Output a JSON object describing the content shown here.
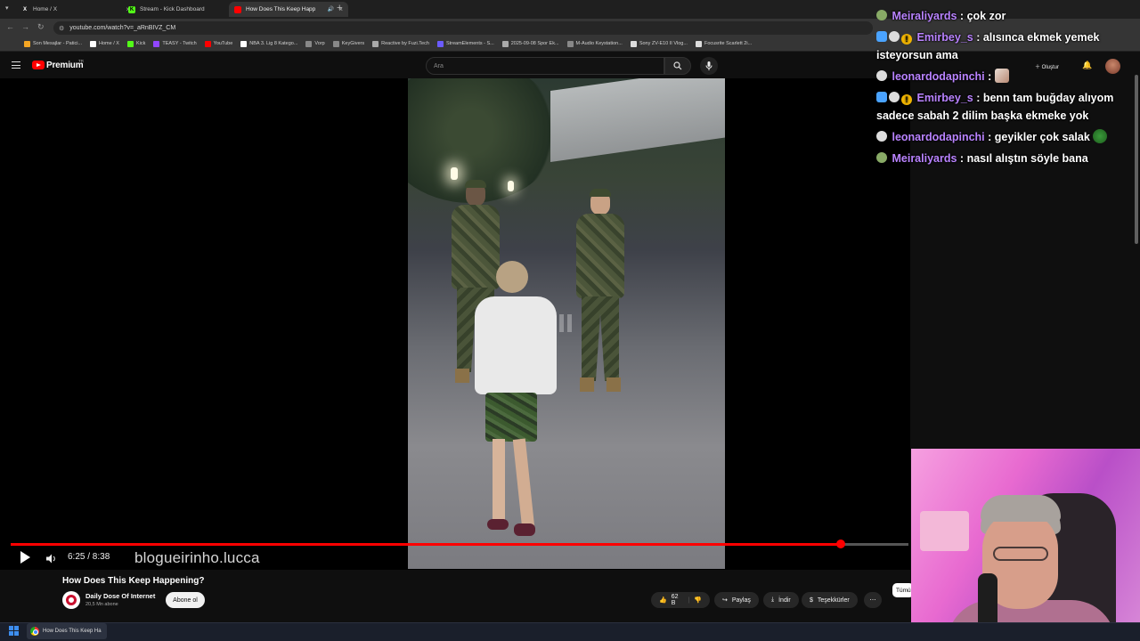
{
  "browser": {
    "tabs": [
      {
        "label": "Home / X",
        "favicon": "x-icon",
        "active": false
      },
      {
        "label": "Stream - Kick Dashboard",
        "favicon": "kick-icon",
        "active": false
      },
      {
        "label": "How Does This Keep Happ",
        "favicon": "youtube-icon",
        "active": true
      }
    ],
    "url": "youtube.com/watch?v=_aRnBIVZ_CM",
    "bookmarks": [
      {
        "label": "Son Mesajlar - Patici...",
        "color": "#f5a623"
      },
      {
        "label": "Home / X",
        "color": "#ffffff"
      },
      {
        "label": "Kick",
        "color": "#53fc18"
      },
      {
        "label": "TEASY - Twitch",
        "color": "#9146ff"
      },
      {
        "label": "YouTube",
        "color": "#ff0000"
      },
      {
        "label": "NBA 3. Lig 8 Katego...",
        "color": "#ffffff"
      },
      {
        "label": "Vorp",
        "color": "#888888"
      },
      {
        "label": "KeyGivers",
        "color": "#888888"
      },
      {
        "label": "Reactive by Fuzi.Tech",
        "color": "#aaaaaa"
      },
      {
        "label": "StreamElements - S...",
        "color": "#6b5bff"
      },
      {
        "label": "2025-09-08 Spor Ek...",
        "color": "#aaaaaa"
      },
      {
        "label": "M-Audio Keystation...",
        "color": "#888888"
      },
      {
        "label": "Sony ZV-E10 II Vlog...",
        "color": "#dddddd"
      },
      {
        "label": "Focusrite Scarlett 2i...",
        "color": "#dddddd"
      }
    ]
  },
  "youtube": {
    "logo_text": "Premium",
    "region": "TR",
    "search_placeholder": "Ara",
    "create_label": "Oluştur",
    "video": {
      "watermark": "blogueirinho.lucca",
      "time": "6:25 / 8:38",
      "progress": 0.925,
      "title": "How Does This Keep Happening?",
      "channel": "Daily Dose Of Internet",
      "subscribers": "20,5 Mn abone",
      "subscribe_label": "Abone ol",
      "likes": "62 B",
      "share_label": "Paylaş",
      "download_label": "İndir",
      "thanks_label": "Teşekkürler",
      "all_label": "Tümü"
    }
  },
  "chat": {
    "messages": [
      {
        "user": "Meiraliyards",
        "text": "çok zor",
        "badges": [
          "cat"
        ]
      },
      {
        "user": "Emirbey_s",
        "text": "alısınca ekmek yemek isteyorsun ama",
        "badges": [
          "mod",
          "sub",
          "gold"
        ]
      },
      {
        "user": "leonardodapinchi",
        "text": "",
        "badges": [
          "sub"
        ],
        "emote": true
      },
      {
        "user": "Emirbey_s",
        "text": "benn tam buğday alıyom sadece sabah 2 dilim başka ekmeke yok",
        "badges": [
          "mod",
          "sub",
          "gold"
        ]
      },
      {
        "user": "leonardodapinchi",
        "text": "geyikler çok salak",
        "badges": [
          "sub"
        ],
        "emote": true
      },
      {
        "user": "Meiraliyards",
        "text": "nasıl alıştın söyle bana",
        "badges": [
          "cat"
        ]
      }
    ]
  },
  "taskbar": {
    "app_label": "How Does This Keep Ha"
  },
  "colors": {
    "accent": "#ff0000",
    "username": "#b983ff",
    "background": "#0f0f0f"
  }
}
